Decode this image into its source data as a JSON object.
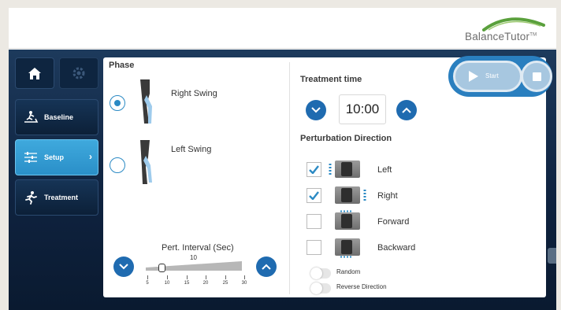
{
  "brand": {
    "logo_text": "BalanceTutor",
    "trademark": "TM"
  },
  "sidebar": {
    "items": [
      {
        "label": "Baseline",
        "icon": "treadmill-icon"
      },
      {
        "label": "Setup",
        "icon": "setup-list-icon"
      },
      {
        "label": "Treatment",
        "icon": "running-person-icon"
      }
    ]
  },
  "phase": {
    "title": "Phase",
    "options": [
      {
        "label": "Right Swing",
        "selected": true
      },
      {
        "label": "Left Swing",
        "selected": false
      }
    ]
  },
  "interval": {
    "title": "Pert. Interval (Sec)",
    "value": "10",
    "ticks": [
      "5",
      "10",
      "15",
      "20",
      "25",
      "30"
    ]
  },
  "treatment": {
    "title": "Treatment time",
    "time": "10:00"
  },
  "perturbation": {
    "title": "Perturbation Direction",
    "directions": [
      {
        "label": "Left",
        "checked": true
      },
      {
        "label": "Right",
        "checked": true
      },
      {
        "label": "Forward",
        "checked": false
      },
      {
        "label": "Backward",
        "checked": false
      }
    ]
  },
  "options": {
    "random_label": "Random",
    "reverse_label": "Reverse Direction"
  },
  "transport": {
    "start_label": "Start"
  },
  "colors": {
    "accent": "#2b8ac4",
    "active_tab": "#3fa9dd",
    "background": "#0f2340"
  }
}
